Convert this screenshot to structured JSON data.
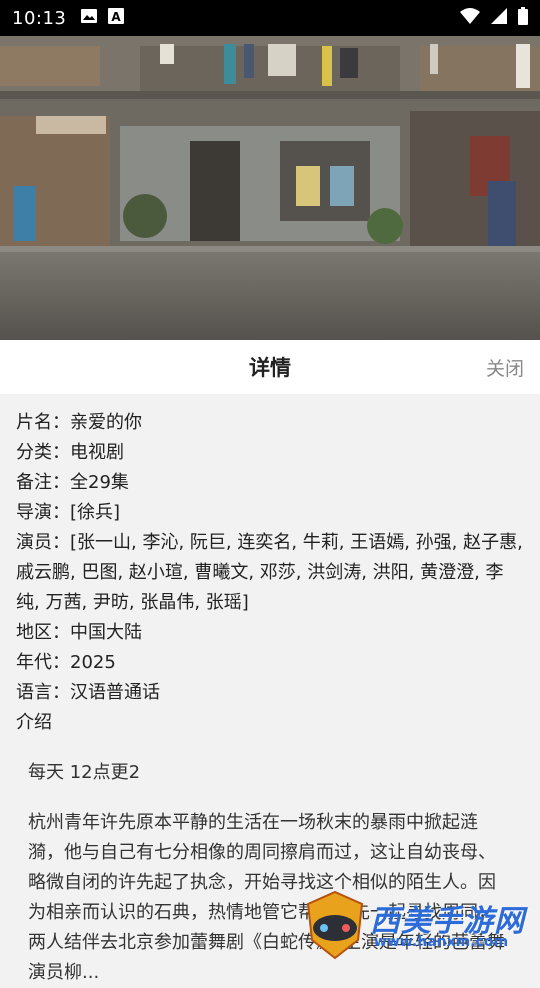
{
  "status_bar": {
    "time": "10:13",
    "left_icons": [
      "image-icon",
      "text-a-icon"
    ],
    "right_icons": [
      "wifi-icon",
      "signal-icon",
      "battery-icon"
    ]
  },
  "hero": {
    "description_icon": "street-scene-image"
  },
  "header": {
    "title": "详情",
    "close_label": "关闭"
  },
  "info": [
    {
      "label": "片名：",
      "value": "亲爱的你"
    },
    {
      "label": "分类：",
      "value": "电视剧"
    },
    {
      "label": "备注：",
      "value": "全29集"
    },
    {
      "label": "导演：",
      "value": "[徐兵]"
    },
    {
      "label": "演员：",
      "value": "[张一山, 李沁, 阮巨, 连奕名, 牛莉, 王语嫣, 孙强, 赵子惠, 戚云鹏, 巴图, 赵小瑄, 曹曦文, 邓莎, 洪剑涛, 洪阳, 黄澄澄, 李纯, 万茜, 尹昉, 张晶伟, 张瑶]"
    },
    {
      "label": "地区：",
      "value": "中国大陆"
    },
    {
      "label": "年代：",
      "value": "2025"
    },
    {
      "label": "语言：",
      "value": "汉语普通话"
    }
  ],
  "intro_label": "介绍",
  "intro_paragraphs": [
    "每天 12点更2",
    "杭州青年许先原本平静的生活在一场秋末的暴雨中掀起涟漪，他与自己有七分相像的周同擦肩而过，这让自幼丧母、略微自闭的许先起了执念，开始寻找这个相似的陌生人。因为相亲而认识的石典，热情地管它帮助许先一起寻找周同，两人结伴去北京参加蕾舞剧《白蛇传》，主演是年轻的芭蕾舞演员柳..."
  ],
  "watermark": {
    "text": "西美手游网",
    "url": "www.hanxm.com"
  }
}
